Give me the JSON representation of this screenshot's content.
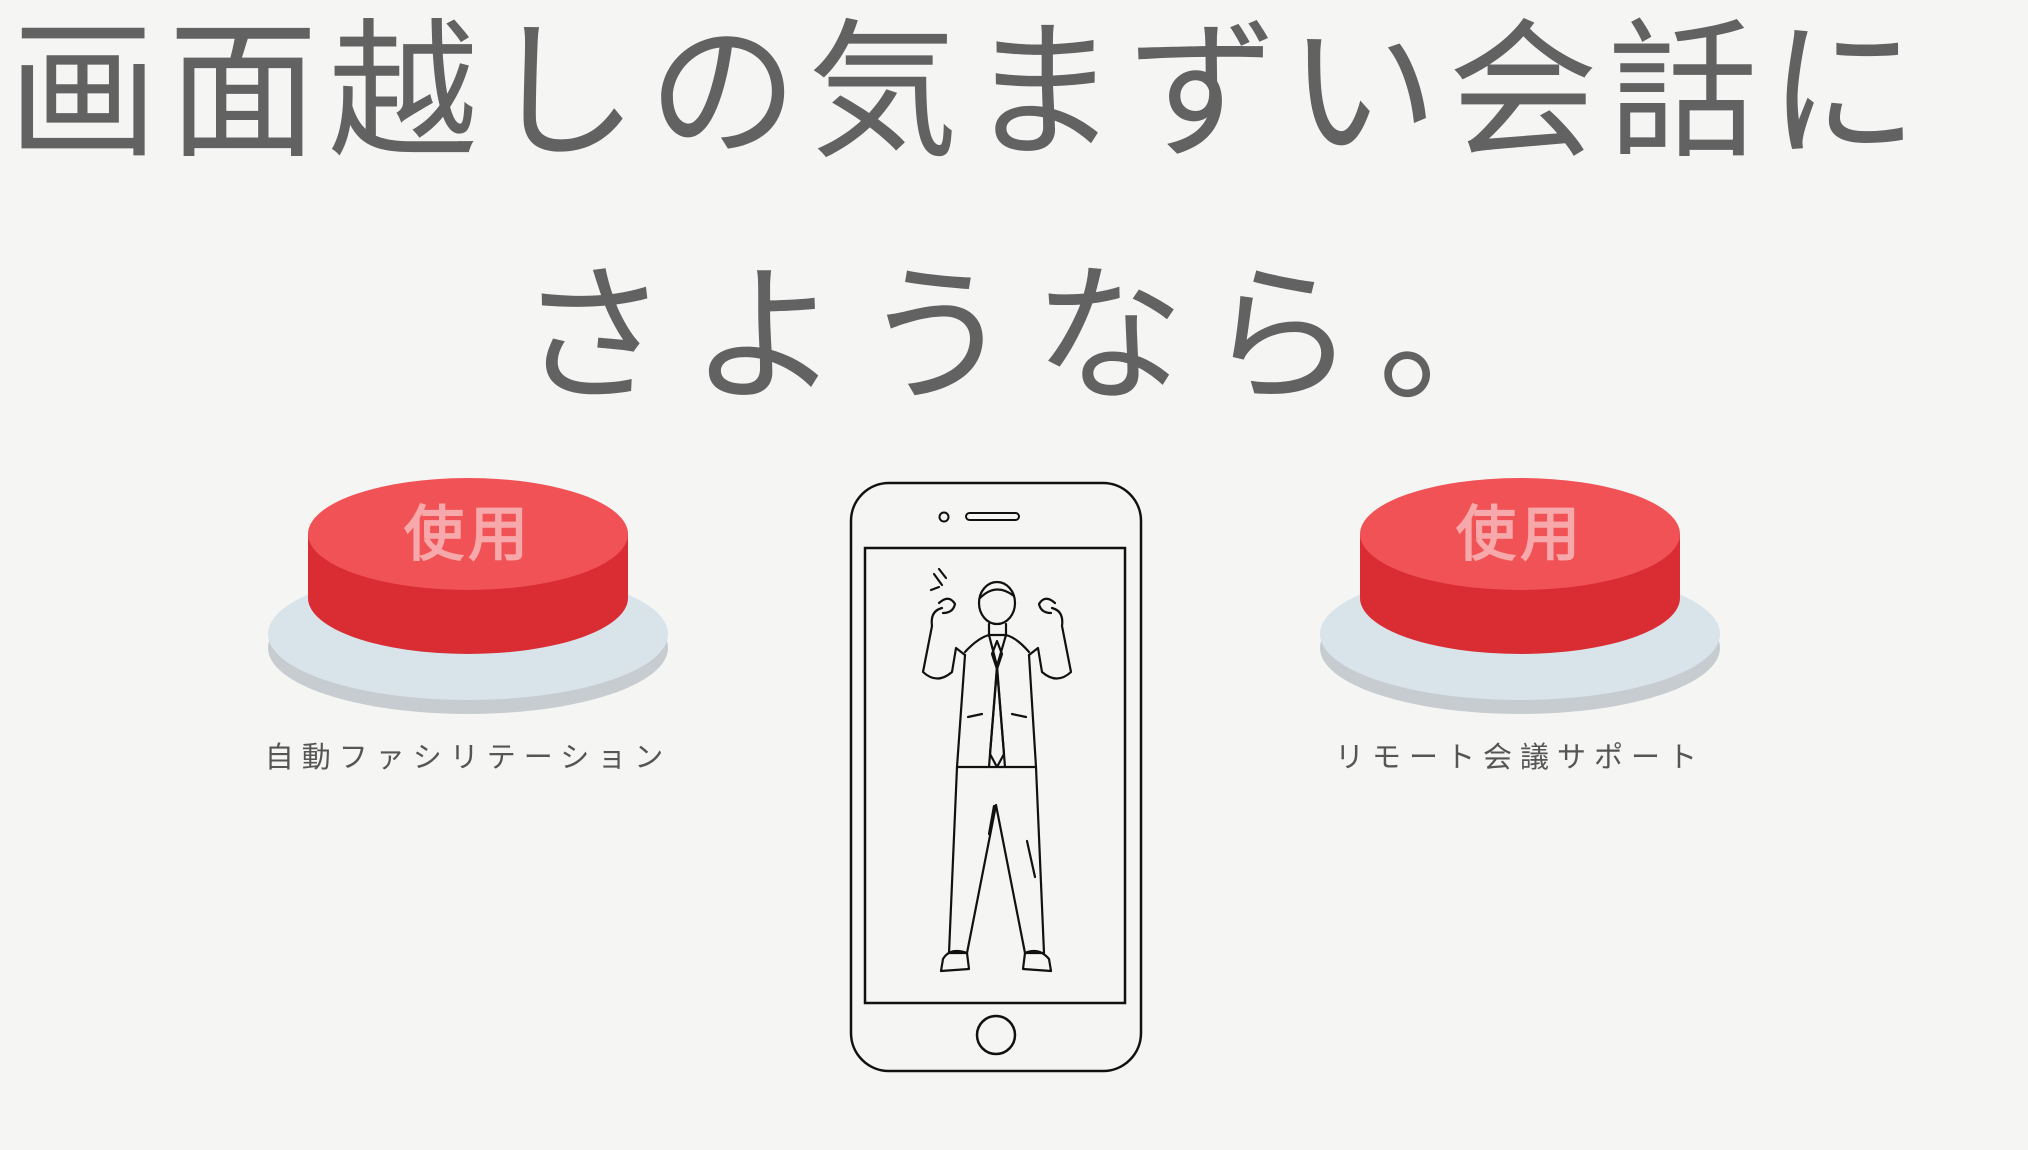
{
  "headline": {
    "line1": "画面越しの気まずい会話に",
    "line2": "さようなら。"
  },
  "features": [
    {
      "button_label": "使用",
      "caption": "自動ファシリテーション"
    },
    {
      "button_label": "使用",
      "caption": "リモート会議サポート"
    }
  ],
  "colors": {
    "background": "#f5f5f4",
    "headline": "#626262",
    "button_top": "#f15255",
    "button_side": "#d92d33",
    "button_base": "#d9e3ea",
    "button_text": "#f7a8aa"
  },
  "icons": {
    "phone": "smartphone-icon",
    "person": "celebrating-businessman-illustration"
  }
}
